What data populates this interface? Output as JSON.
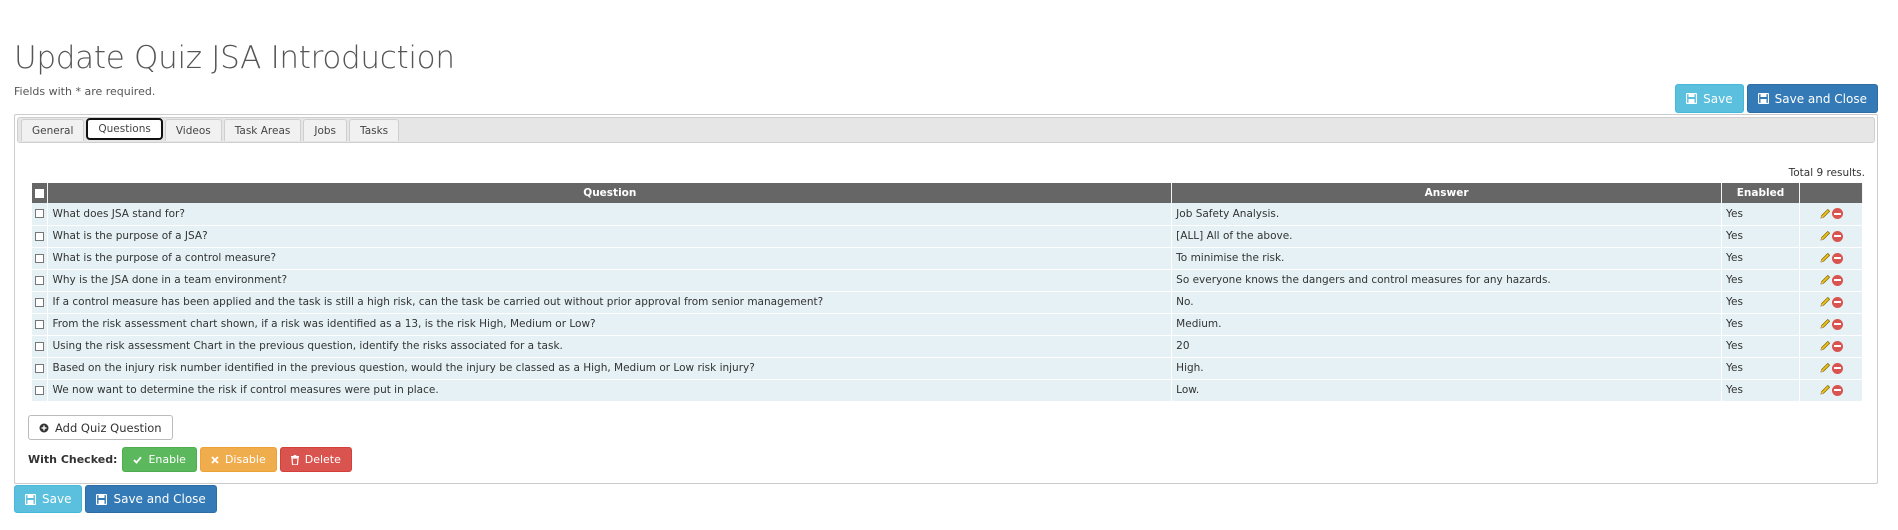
{
  "page": {
    "title": "Update Quiz JSA Introduction",
    "required_note": "Fields with * are required."
  },
  "actions": {
    "save_label": "Save",
    "save_close_label": "Save and Close"
  },
  "tabs": [
    {
      "label": "General"
    },
    {
      "label": "Questions",
      "active": true
    },
    {
      "label": "Videos"
    },
    {
      "label": "Task Areas"
    },
    {
      "label": "Jobs"
    },
    {
      "label": "Tasks"
    }
  ],
  "results": {
    "summary": "Total 9 results.",
    "columns": {
      "question": "Question",
      "answer": "Answer",
      "enabled": "Enabled"
    },
    "rows": [
      {
        "question": "What does JSA stand for?",
        "answer": "Job Safety Analysis.",
        "enabled": "Yes"
      },
      {
        "question": "What is the purpose of a JSA?",
        "answer": "[ALL] All of the above.",
        "enabled": "Yes"
      },
      {
        "question": "What is the purpose of a control measure?",
        "answer": "To minimise the risk.",
        "enabled": "Yes"
      },
      {
        "question": "Why is the JSA done in a team environment?",
        "answer": "So everyone knows the dangers and control measures for any hazards.",
        "enabled": "Yes"
      },
      {
        "question": "If a control measure has been applied and the task is still a high risk, can the task be carried out without prior approval from senior management?",
        "answer": "No.",
        "enabled": "Yes"
      },
      {
        "question": "From the risk assessment chart shown, if a risk was identified as a 13, is the risk High, Medium or Low?",
        "answer": "Medium.",
        "enabled": "Yes"
      },
      {
        "question": "Using the risk assessment Chart in the previous question, identify the risks associated for a task.",
        "answer": "20",
        "enabled": "Yes"
      },
      {
        "question": "Based on the injury risk number identified in the previous question, would the injury be classed as a High, Medium or Low risk injury?",
        "answer": "High.",
        "enabled": "Yes"
      },
      {
        "question": "We now want to determine the risk if control measures were put in place.",
        "answer": "Low.",
        "enabled": "Yes"
      }
    ]
  },
  "add_question_label": "Add Quiz Question",
  "bulk": {
    "label": "With Checked:",
    "enable_label": "Enable",
    "disable_label": "Disable",
    "delete_label": "Delete"
  },
  "icons": {
    "save": "floppy-disk-icon",
    "add": "plus-circle-icon",
    "enable": "check-icon",
    "disable": "x-icon",
    "delete": "trash-icon",
    "edit": "pencil-icon",
    "remove": "minus-circle-icon"
  },
  "colors": {
    "info": "#5bc0de",
    "primary": "#337ab7",
    "success": "#5cb85c",
    "warning": "#f0ad4e",
    "danger": "#d9534f",
    "table_header": "#666666",
    "table_row": "#e5f1f4"
  }
}
